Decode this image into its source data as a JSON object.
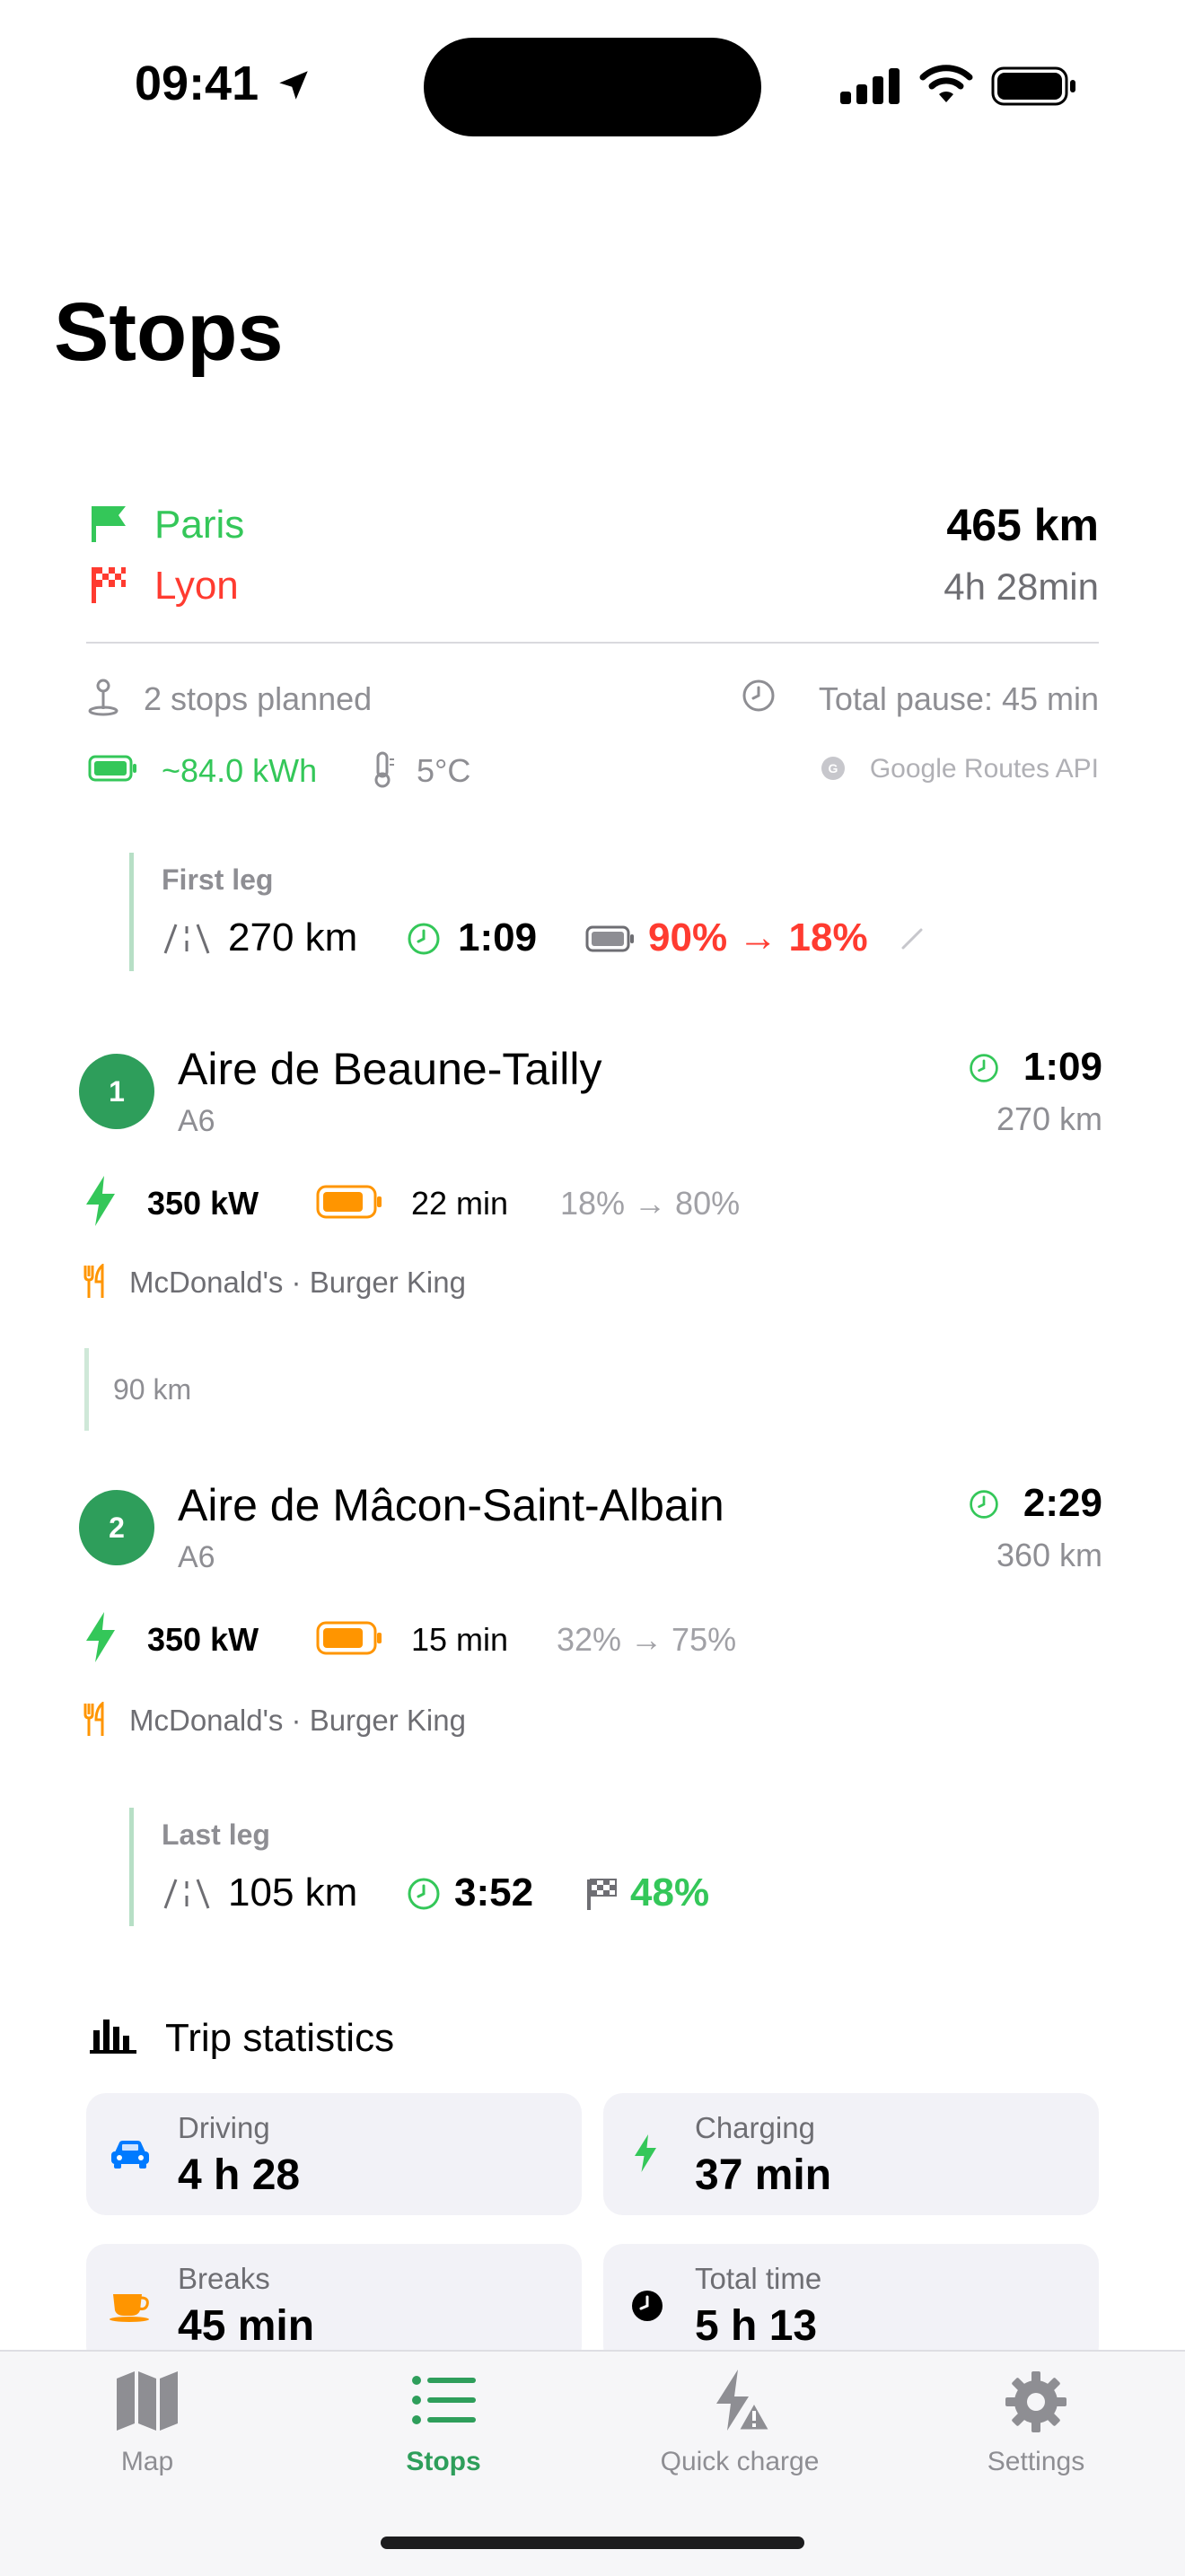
{
  "status": {
    "time": "09:41"
  },
  "page_title": "Stops",
  "route": {
    "origin": "Paris",
    "destination": "Lyon",
    "distance": "465 km",
    "duration": "4h 28min",
    "stops_planned": "2 stops planned",
    "total_pause": "Total pause: 45 min",
    "energy": "~84.0 kWh",
    "temperature": "5°C",
    "source": "Google Routes API"
  },
  "first_leg": {
    "label": "First leg",
    "distance": "270 km",
    "time": "1:09",
    "battery": "90% → 18%"
  },
  "stops": [
    {
      "number": "1",
      "name": "Aire de Beaune-Tailly",
      "road": "A6",
      "arrival": "1:09",
      "distance": "270 km",
      "power": "350 kW",
      "charge_time": "22 min",
      "soc": "18% → 80%",
      "food": "McDonald's · Burger King"
    },
    {
      "number": "2",
      "name": "Aire de Mâcon-Saint-Albain",
      "road": "A6",
      "arrival": "2:29",
      "distance": "360 km",
      "power": "350 kW",
      "charge_time": "15 min",
      "soc": "32% → 75%",
      "food": "McDonald's · Burger King"
    }
  ],
  "between_stops": "90 km",
  "last_leg": {
    "label": "Last leg",
    "distance": "105 km",
    "time": "3:52",
    "arrival_soc": "48%"
  },
  "trip_stats": {
    "title": "Trip statistics",
    "driving_label": "Driving",
    "driving_value": "4 h 28",
    "charging_label": "Charging",
    "charging_value": "37 min",
    "breaks_label": "Breaks",
    "breaks_value": "45 min",
    "total_label": "Total time",
    "total_value": "5 h 13"
  },
  "tabs": {
    "map": "Map",
    "stops": "Stops",
    "quick_charge": "Quick charge",
    "settings": "Settings",
    "active": "Stops"
  },
  "colors": {
    "green": "#34c759",
    "dark_green": "#2e9e5b",
    "red": "#ff3b30",
    "orange": "#ff9500",
    "blue": "#007aff"
  }
}
